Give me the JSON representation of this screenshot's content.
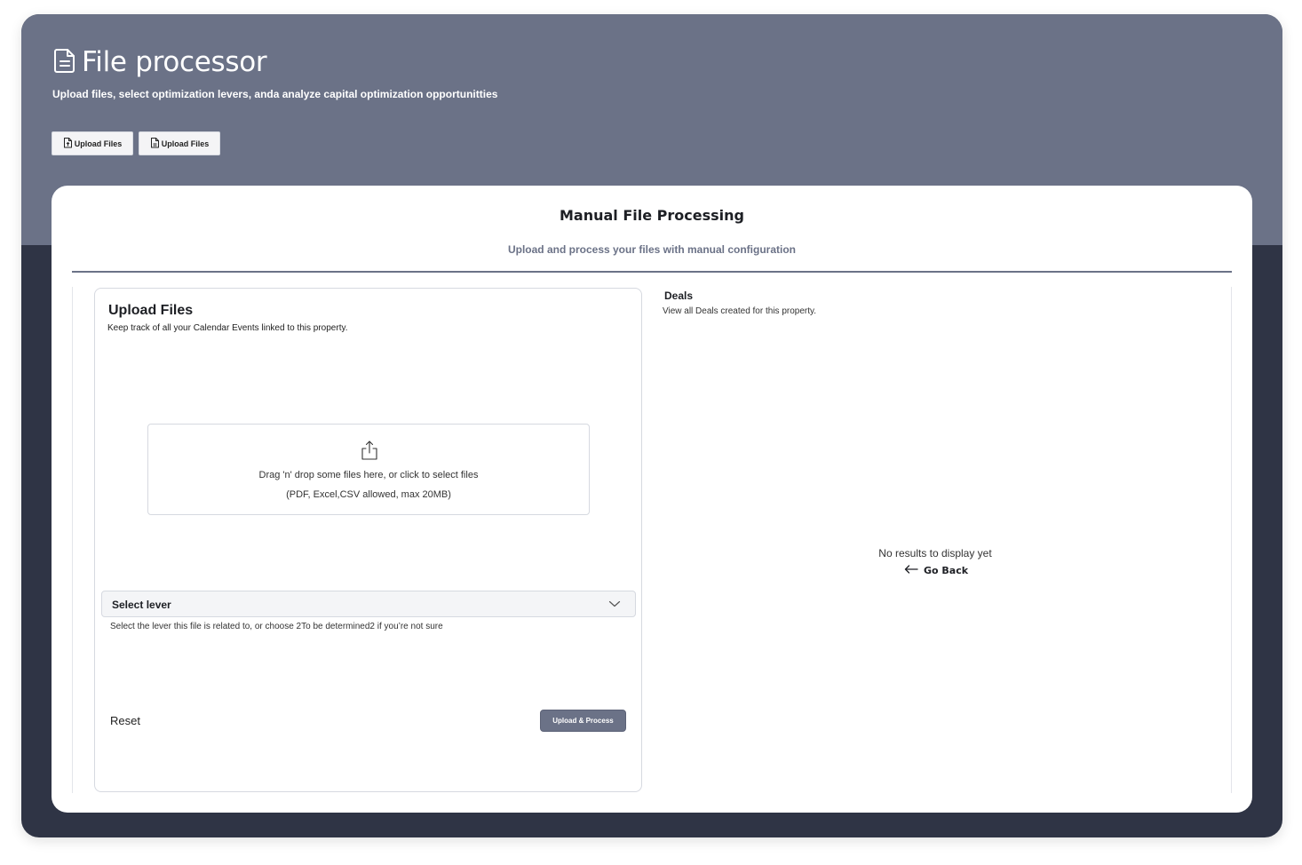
{
  "header": {
    "title": "File processor",
    "subtitle": "Upload files, select optimization levers, anda analyze capital optimization opportunitties",
    "title_icon": "file-text-icon",
    "actions": [
      {
        "label": "Upload Files",
        "icon": "file-upload-icon"
      },
      {
        "label": "Upload Files",
        "icon": "file-text-icon"
      }
    ]
  },
  "card": {
    "title": "Manual File Processing",
    "subtitle": "Upload and process your files with manual configuration"
  },
  "upload_panel": {
    "title": "Upload Files",
    "description": "Keep track of all your Calendar Events linked to this property.",
    "dropzone": {
      "icon": "share-upload-icon",
      "text": "Drag 'n' drop some files here, or click to select files",
      "hint": "(PDF, Excel,CSV allowed, max 20MB)"
    },
    "lever_select": {
      "selected": "Select lever",
      "help": "Select the lever this file is related to, or choose 2To be determined2 if you’re not sure"
    },
    "reset_label": "Reset",
    "submit_label": "Upload & Process"
  },
  "deals_panel": {
    "title": "Deals",
    "description": "View all Deals created for this property.",
    "empty_text": "No results to display yet",
    "back_label": "Go Back"
  },
  "colors": {
    "header_bg": "#6b7287",
    "frame_bg": "#2f3445",
    "accent": "#6b7287"
  }
}
